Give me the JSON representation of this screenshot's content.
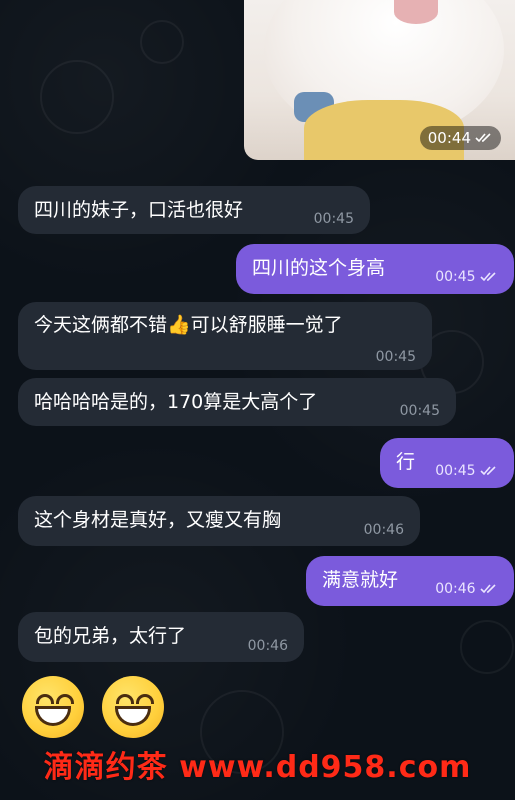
{
  "photo": {
    "time": "00:44"
  },
  "messages": [
    {
      "text": "四川的妹子，口活也很好",
      "time": "00:45",
      "direction": "in"
    },
    {
      "text": "四川的这个身高",
      "time": "00:45",
      "direction": "out"
    },
    {
      "text": "今天这俩都不错👍可以舒服睡一觉了",
      "time": "00:45",
      "direction": "in"
    },
    {
      "text": "哈哈哈哈是的，170算是大高个了",
      "time": "00:45",
      "direction": "in"
    },
    {
      "text": "行",
      "time": "00:45",
      "direction": "out"
    },
    {
      "text": "这个身材是真好，又瘦又有胸",
      "time": "00:46",
      "direction": "in"
    },
    {
      "text": "满意就好",
      "time": "00:46",
      "direction": "out"
    },
    {
      "text": "包的兄弟，太行了",
      "time": "00:46",
      "direction": "in"
    }
  ],
  "emojis": [
    "grinning-face",
    "grinning-face"
  ],
  "watermark": "滴滴约茶 www.dd958.com",
  "colors": {
    "background": "#0c1219",
    "incoming_bubble": "#242b35",
    "outgoing_bubble": "#7b5bdc",
    "watermark": "#ff2a17"
  }
}
